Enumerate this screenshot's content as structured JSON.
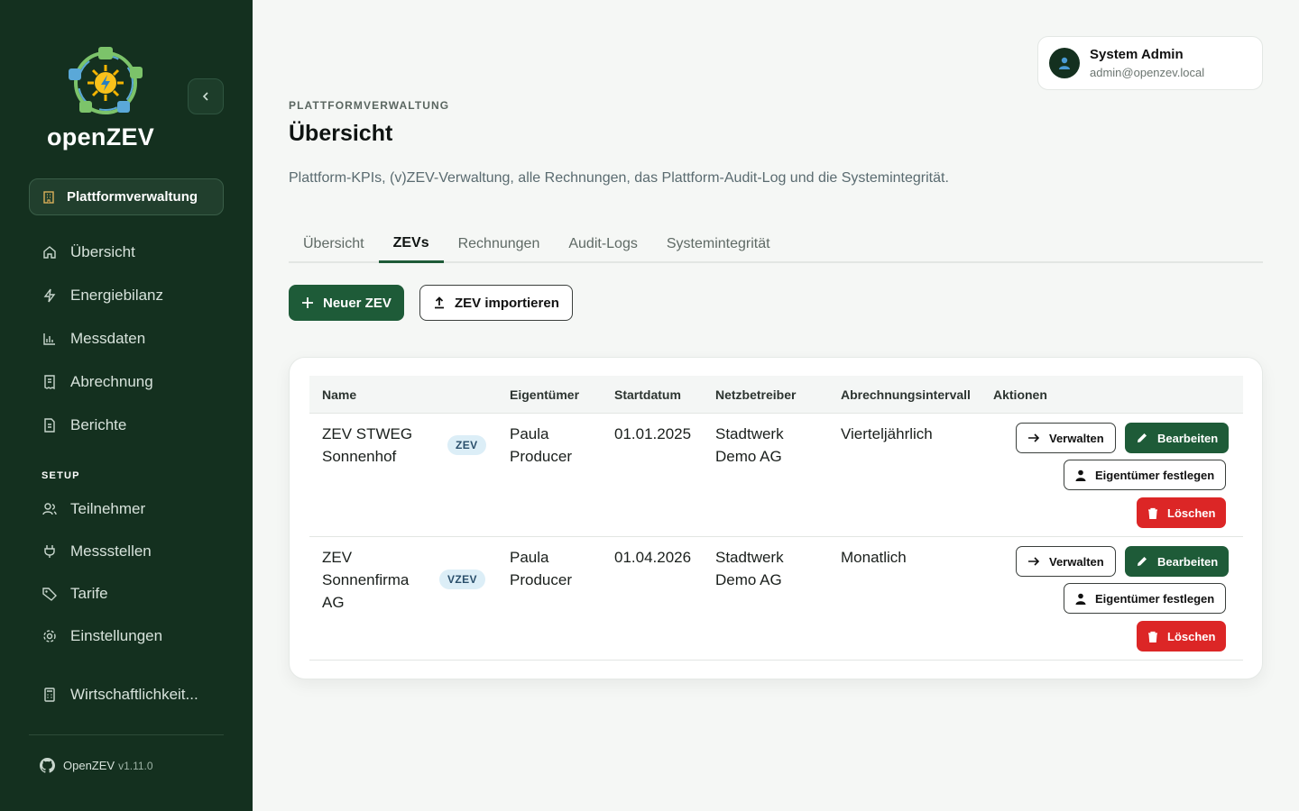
{
  "sidebar": {
    "logo_text": "openZEV",
    "platform_button": "Plattformverwaltung",
    "nav_main": [
      {
        "label": "Übersicht",
        "icon": "home-icon"
      },
      {
        "label": "Energiebilanz",
        "icon": "bolt-icon"
      },
      {
        "label": "Messdaten",
        "icon": "bar-chart-icon"
      },
      {
        "label": "Abrechnung",
        "icon": "receipt-icon"
      },
      {
        "label": "Berichte",
        "icon": "document-icon"
      }
    ],
    "section_setup": "SETUP",
    "nav_setup": [
      {
        "label": "Teilnehmer",
        "icon": "users-icon"
      },
      {
        "label": "Messstellen",
        "icon": "plug-icon"
      },
      {
        "label": "Tarife",
        "icon": "tag-icon"
      },
      {
        "label": "Einstellungen",
        "icon": "gear-icon"
      }
    ],
    "nav_extra": {
      "label": "Wirtschaftlichkeit...",
      "icon": "calculator-icon"
    },
    "footer": {
      "name": "OpenZEV",
      "version": "v1.11.0"
    }
  },
  "user": {
    "name": "System Admin",
    "email": "admin@openzev.local"
  },
  "header": {
    "eyebrow": "PLATTFORMVERWALTUNG",
    "title": "Übersicht",
    "description": "Plattform-KPIs, (v)ZEV-Verwaltung, alle Rechnungen, das Plattform-Audit-Log und die Systemintegrität."
  },
  "tabs": [
    "Übersicht",
    "ZEVs",
    "Rechnungen",
    "Audit-Logs",
    "Systemintegrität"
  ],
  "active_tab": "ZEVs",
  "toolbar": {
    "new_label": "Neuer ZEV",
    "import_label": "ZEV importieren"
  },
  "table": {
    "columns": [
      "Name",
      "Eigentümer",
      "Startdatum",
      "Netzbetreiber",
      "Abrechnungsintervall",
      "Aktionen"
    ],
    "rows": [
      {
        "name": "ZEV STWEG Sonnenhof",
        "name_lines": [
          "ZEV STWEG",
          "Sonnenhof"
        ],
        "badge": "ZEV",
        "owner_lines": [
          "Paula",
          "Producer"
        ],
        "start": "01.01.2025",
        "operator_lines": [
          "Stadtwerk",
          "Demo AG"
        ],
        "interval": "Vierteljährlich"
      },
      {
        "name": "ZEV Sonnenfirma AG",
        "name_lines": [
          "ZEV",
          "Sonnenfirma",
          "AG"
        ],
        "badge": "VZEV",
        "owner_lines": [
          "Paula",
          "Producer"
        ],
        "start": "01.04.2026",
        "operator_lines": [
          "Stadtwerk",
          "Demo AG"
        ],
        "interval": "Monatlich"
      }
    ],
    "actions": {
      "manage": "Verwalten",
      "edit": "Bearbeiten",
      "set_owner": "Eigentümer festlegen",
      "delete": "Löschen"
    }
  },
  "colors": {
    "sidebar_bg": "#14301f",
    "primary": "#1e5b38",
    "danger": "#dc2626",
    "badge_bg": "#dceef7"
  }
}
